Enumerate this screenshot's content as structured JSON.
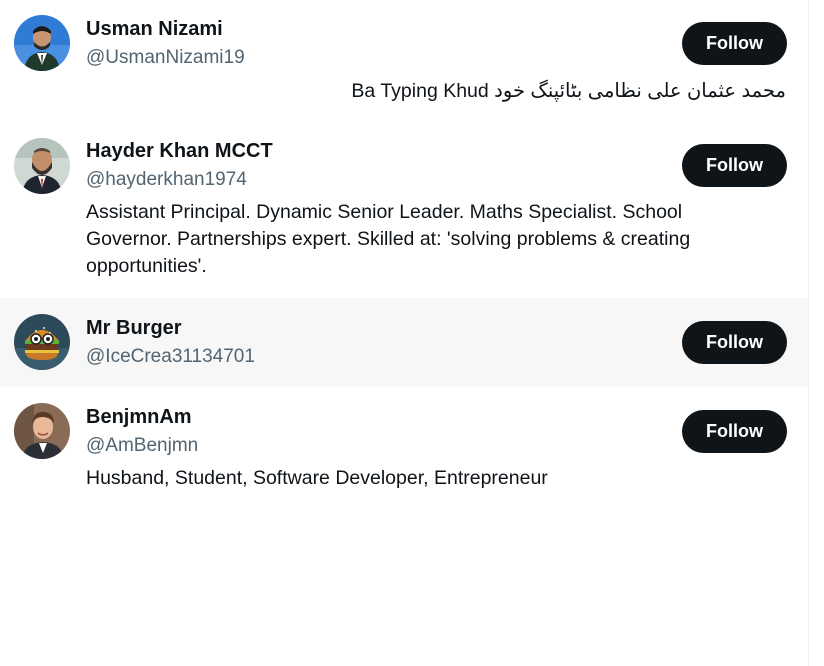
{
  "users": [
    {
      "name": "Usman Nizami",
      "handle": "@UsmanNizami19",
      "bio": "محمد عثمان علی نظامی بٹائپنگ خود Ba Typing Khud",
      "follow_label": "Follow",
      "avatar_icon": "person-blue-background-avatar"
    },
    {
      "name": "Hayder Khan MCCT",
      "handle": "@hayderkhan1974",
      "bio": "Assistant Principal. Dynamic Senior Leader. Maths Specialist. School Governor. Partnerships expert. Skilled at: 'solving problems & creating opportunities'.",
      "follow_label": "Follow",
      "avatar_icon": "bearded-man-avatar"
    },
    {
      "name": "Mr Burger",
      "handle": "@IceCrea31134701",
      "bio": "",
      "follow_label": "Follow",
      "avatar_icon": "burger-with-glasses-avatar"
    },
    {
      "name": "BenjmnAm",
      "handle": "@AmBenjmn",
      "bio": "Husband, Student, Software Developer, Entrepreneur",
      "follow_label": "Follow",
      "avatar_icon": "young-man-avatar"
    }
  ],
  "colors": {
    "button_bg": "#0f1419",
    "button_text": "#ffffff",
    "name_text": "#0f1419",
    "handle_text": "#536471",
    "hover_row_bg": "#f7f7f7"
  }
}
